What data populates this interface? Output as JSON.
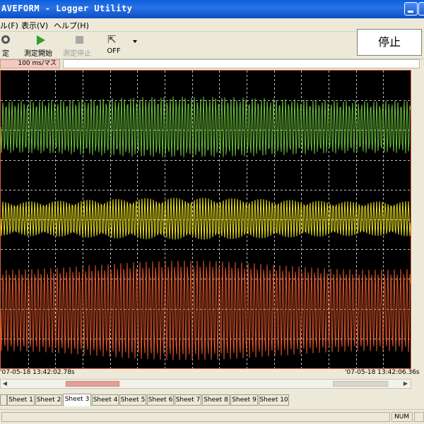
{
  "window": {
    "title": "AVEFORM - Logger Utility"
  },
  "menu": [
    {
      "label": "ル(F)"
    },
    {
      "label": "表示(V)"
    },
    {
      "label": "ヘルプ(H)"
    }
  ],
  "toolbar": {
    "settings_label": "定",
    "start_label": "測定開始",
    "stop_label": "測定停止",
    "mode_label": "OFF"
  },
  "status": {
    "state": "停止"
  },
  "scale": {
    "label": "100 ms/マス"
  },
  "time": {
    "start": "'07-05-18 13:42:02.78s",
    "end": "'07-05-18 13:42:06.36s"
  },
  "tabs": [
    {
      "label": "Sheet 1"
    },
    {
      "label": "Sheet 2"
    },
    {
      "label": "Sheet 3",
      "active": true
    },
    {
      "label": "Sheet 4"
    },
    {
      "label": "Sheet 5"
    },
    {
      "label": "Sheet 6"
    },
    {
      "label": "Sheet 7"
    },
    {
      "label": "Sheet 8"
    },
    {
      "label": "Sheet 9"
    },
    {
      "label": "Sheet 10"
    }
  ],
  "statusbar": {
    "num": "NUM"
  },
  "colors": {
    "ch1": "#6ec43c",
    "ch2": "#f0e61e",
    "ch3": "#e65a2a",
    "grid": "#bfbfbf"
  }
}
